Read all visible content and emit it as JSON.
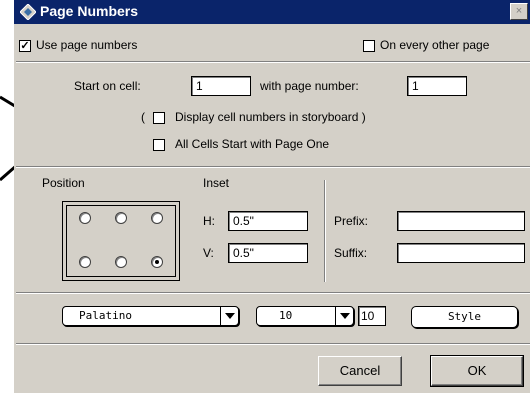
{
  "window": {
    "title": "Page Numbers",
    "close_label": "×"
  },
  "options": {
    "use_page_numbers": {
      "label": "Use page numbers",
      "checked": true,
      "mark": "✓"
    },
    "every_other_page": {
      "label": "On every other page",
      "checked": false
    }
  },
  "start": {
    "start_on_cell_label": "Start on cell:",
    "start_on_cell_value": "1",
    "with_page_number_label": "with page number:",
    "with_page_number_value": "1"
  },
  "display_cell_numbers": {
    "open_paren": "(",
    "label": "Display cell numbers in storyboard )",
    "checked": false
  },
  "all_cells_start": {
    "label": "All Cells Start with Page One",
    "checked": false
  },
  "position": {
    "label": "Position",
    "selected_index": 5
  },
  "inset": {
    "label": "Inset",
    "h_label": "H:",
    "h_value": "0.5\"",
    "v_label": "V:",
    "v_value": "0.5\""
  },
  "affix": {
    "prefix_label": "Prefix:",
    "prefix_value": "",
    "suffix_label": "Suffix:",
    "suffix_value": ""
  },
  "font": {
    "family_value": "Palatino",
    "size_value": "10",
    "size_field_value": "10",
    "style_label": "Style"
  },
  "buttons": {
    "cancel": "Cancel",
    "ok": "OK"
  }
}
